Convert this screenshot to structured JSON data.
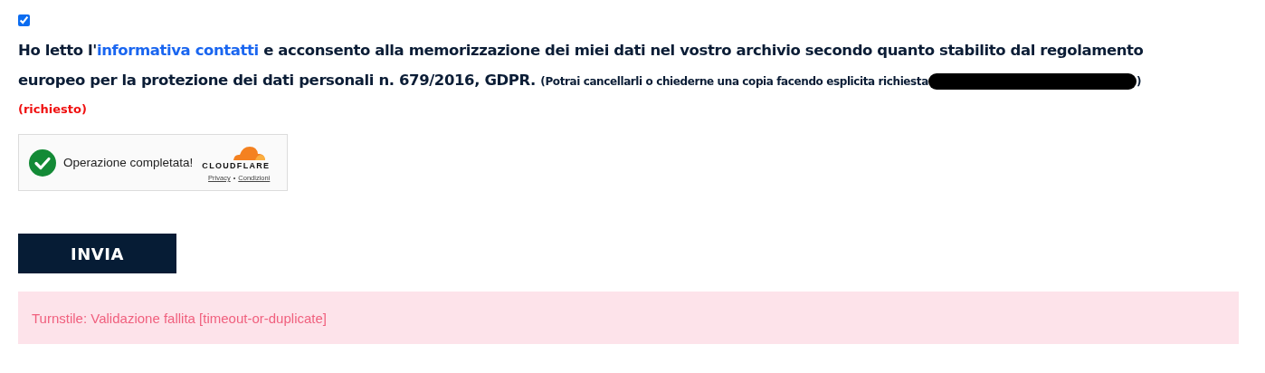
{
  "consent": {
    "checked": true,
    "text_before": "Ho letto l'",
    "link": "informativa contatti",
    "text_after": " e acconsento alla memorizzazione dei miei dati nel vostro archivio secondo quanto stabilito dal regolamento europeo per la protezione dei dati personali n. 679/2016, GDPR.",
    "note": "(Potrai cancellarli o chiederne una copia facendo esplicita richiesta",
    "redacted": true,
    "note_end": ")",
    "required": "(richiesto)"
  },
  "captcha": {
    "kind": "success",
    "message": "Operazione completata!",
    "brand": "CLOUDFLARE",
    "links": [
      "Privacy",
      "Condizioni"
    ],
    "separator": "•"
  },
  "submit": "INVIA",
  "alert": {
    "kind": "error",
    "message": "Turnstile: Validazione fallita [timeout-or-duplicate]"
  }
}
